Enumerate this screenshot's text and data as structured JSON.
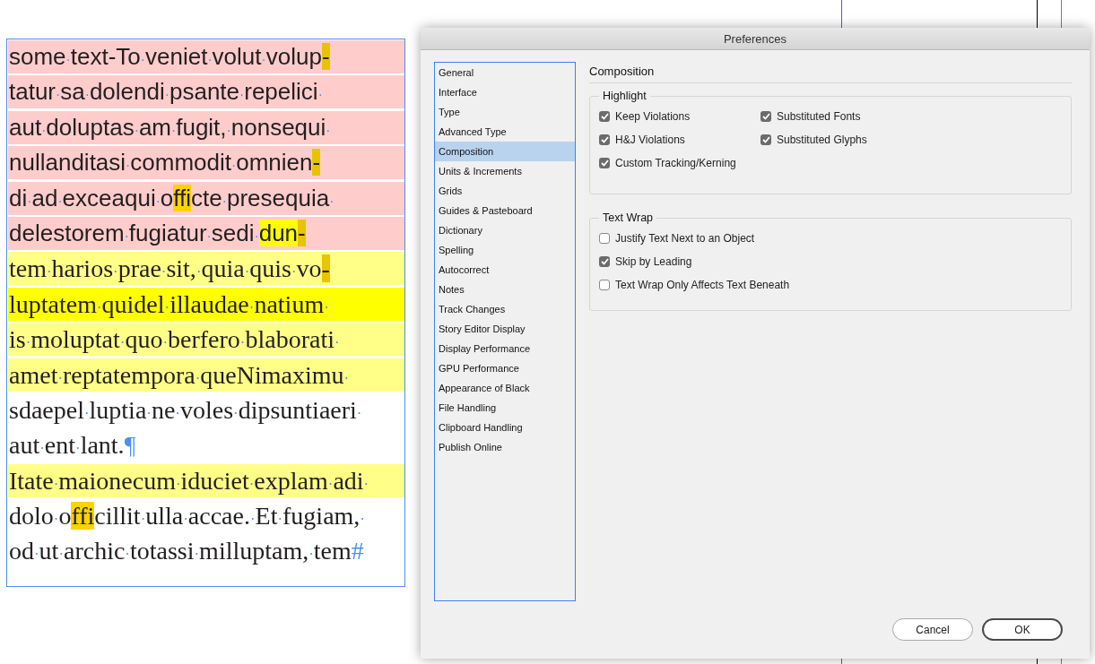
{
  "document": {
    "lines": [
      {
        "kind": "substituted-font",
        "segments": [
          {
            "text": "some·text-To·veniet·volut·volup",
            "kind": "plain"
          },
          {
            "text": "-",
            "kind": "keep"
          }
        ]
      },
      {
        "kind": "substituted-font",
        "segments": [
          {
            "text": "tatur·sa·dolendi·psante·repelici·",
            "kind": "plain"
          }
        ]
      },
      {
        "kind": "substituted-font",
        "segments": [
          {
            "text": "aut·doluptas·am·fugit,·nonsequi·",
            "kind": "plain"
          }
        ]
      },
      {
        "kind": "substituted-font",
        "segments": [
          {
            "text": "nullanditasi·commodit·omnien",
            "kind": "plain"
          },
          {
            "text": "-",
            "kind": "keep"
          }
        ]
      },
      {
        "kind": "substituted-font",
        "segments": [
          {
            "text": "di·ad·exceaqui·o",
            "kind": "plain"
          },
          {
            "text": "ffi",
            "kind": "glyph"
          },
          {
            "text": "cte·presequia·",
            "kind": "plain"
          }
        ]
      },
      {
        "kind": "substituted-font",
        "segments": [
          {
            "text": "delestorem·fugiatur·sedi·",
            "kind": "plain"
          },
          {
            "text": "dun",
            "kind": "loose"
          },
          {
            "text": "-",
            "kind": "keep"
          }
        ]
      },
      {
        "kind": "mild",
        "segments": [
          {
            "text": "tem·harios·prae·sit,·quia·quis·vo",
            "kind": "plain"
          },
          {
            "text": "-",
            "kind": "keep"
          }
        ]
      },
      {
        "kind": "loose",
        "segments": [
          {
            "text": "luptatem·quidel·illaudae·natium·",
            "kind": "plain"
          }
        ]
      },
      {
        "kind": "mild",
        "segments": [
          {
            "text": "is·moluptat·quo·berfero·blaborati·",
            "kind": "plain"
          }
        ]
      },
      {
        "kind": "mild",
        "segments": [
          {
            "text": "amet·reptatempora·queNimaximu·",
            "kind": "plain"
          }
        ]
      },
      {
        "kind": "plain",
        "segments": [
          {
            "text": "sdaepel·luptia·ne·voles·dipsuntiaeri·",
            "kind": "plain"
          }
        ]
      },
      {
        "kind": "plain",
        "segments": [
          {
            "text": "aut·ent·lant.",
            "kind": "plain"
          },
          {
            "text": "¶",
            "kind": "marker"
          }
        ]
      },
      {
        "kind": "mild",
        "segments": [
          {
            "text": "Itate·maionecum·iduciet·explam·adi·",
            "kind": "plain"
          }
        ]
      },
      {
        "kind": "plain",
        "segments": [
          {
            "text": "dolo·o",
            "kind": "plain"
          },
          {
            "text": "ffi",
            "kind": "glyph"
          },
          {
            "text": "cillit·ulla·accae.·Et·fugiam,·",
            "kind": "plain"
          }
        ]
      },
      {
        "kind": "plain",
        "segments": [
          {
            "text": "od·ut·archic·totassi·milluptam,·tem",
            "kind": "plain"
          },
          {
            "text": "#",
            "kind": "marker"
          }
        ]
      }
    ]
  },
  "dialog": {
    "title": "Preferences",
    "sidebar": {
      "items": [
        {
          "label": "General",
          "selected": false
        },
        {
          "label": "Interface",
          "selected": false
        },
        {
          "label": "Type",
          "selected": false
        },
        {
          "label": "Advanced Type",
          "selected": false
        },
        {
          "label": "Composition",
          "selected": true
        },
        {
          "label": "Units & Increments",
          "selected": false
        },
        {
          "label": "Grids",
          "selected": false
        },
        {
          "label": "Guides & Pasteboard",
          "selected": false
        },
        {
          "label": "Dictionary",
          "selected": false
        },
        {
          "label": "Spelling",
          "selected": false
        },
        {
          "label": "Autocorrect",
          "selected": false
        },
        {
          "label": "Notes",
          "selected": false
        },
        {
          "label": "Track Changes",
          "selected": false
        },
        {
          "label": "Story Editor Display",
          "selected": false
        },
        {
          "label": "Display Performance",
          "selected": false
        },
        {
          "label": "GPU Performance",
          "selected": false
        },
        {
          "label": "Appearance of Black",
          "selected": false
        },
        {
          "label": "File Handling",
          "selected": false
        },
        {
          "label": "Clipboard Handling",
          "selected": false
        },
        {
          "label": "Publish Online",
          "selected": false
        }
      ]
    },
    "panel": {
      "title": "Composition",
      "groups": [
        {
          "title": "Highlight",
          "kind": "grid",
          "options": [
            {
              "label": "Keep Violations",
              "checked": true
            },
            {
              "label": "Substituted Fonts",
              "checked": true
            },
            {
              "label": "H&J Violations",
              "checked": true
            },
            {
              "label": "Substituted Glyphs",
              "checked": true
            },
            {
              "label": "Custom Tracking/Kerning",
              "checked": true
            }
          ]
        },
        {
          "title": "Text Wrap",
          "kind": "list",
          "options": [
            {
              "label": "Justify Text Next to an Object",
              "checked": false
            },
            {
              "label": "Skip by Leading",
              "checked": true
            },
            {
              "label": "Text Wrap Only Affects Text Beneath",
              "checked": false
            }
          ]
        }
      ]
    },
    "buttons": [
      {
        "label": "Cancel",
        "default": false
      },
      {
        "label": "OK",
        "default": true
      }
    ]
  }
}
